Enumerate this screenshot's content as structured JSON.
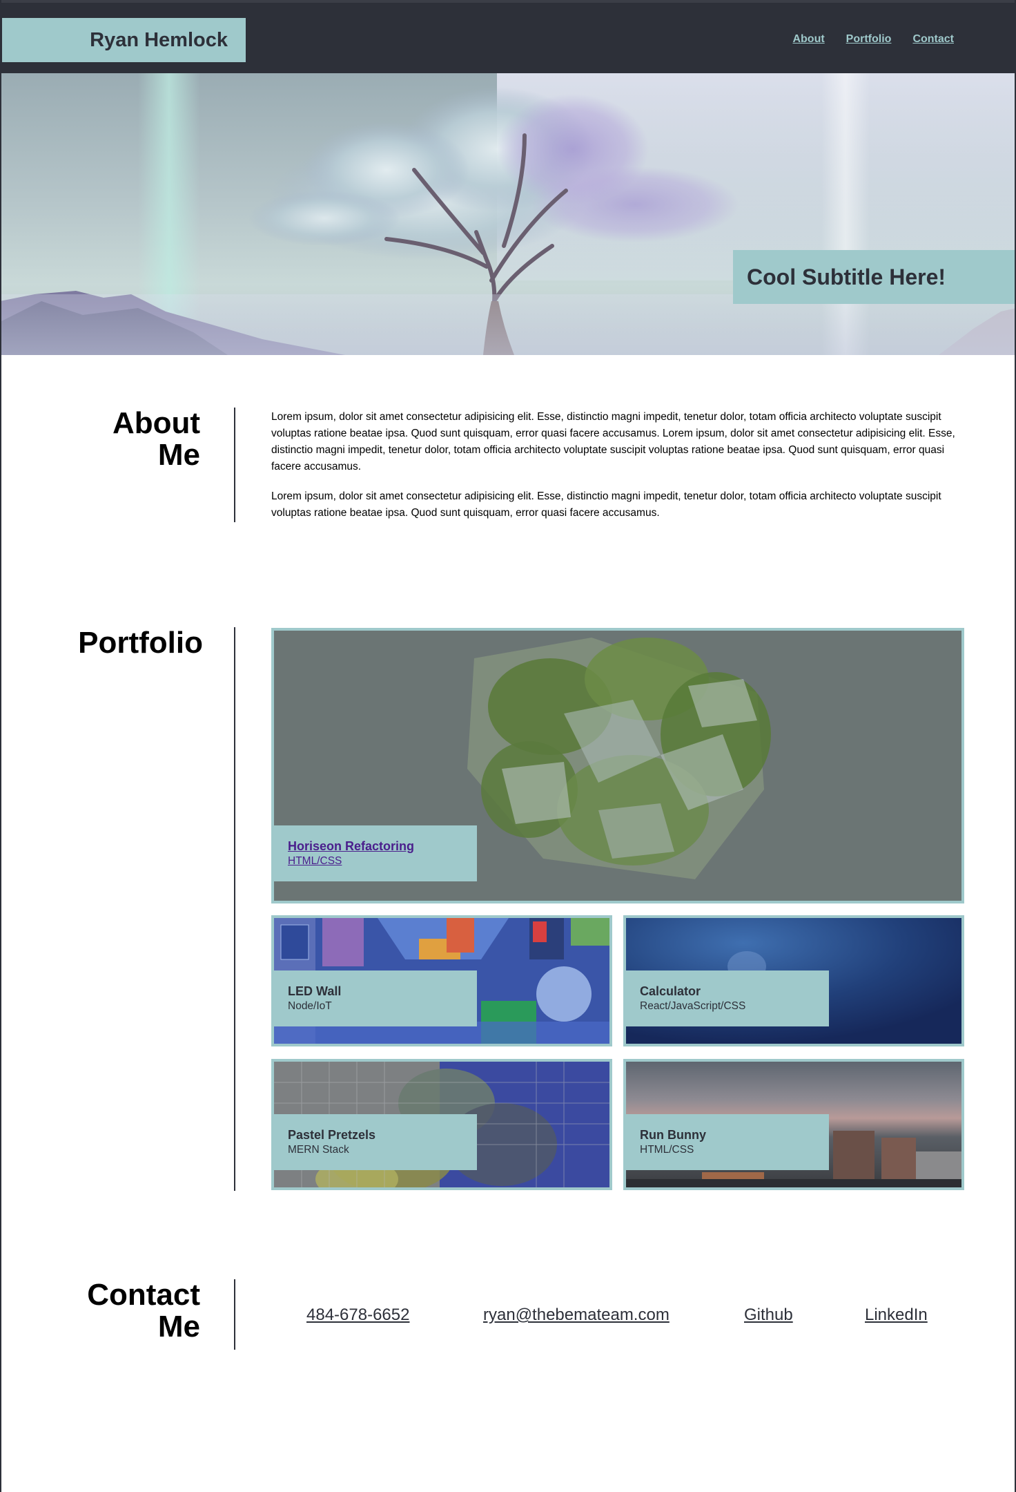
{
  "header": {
    "brand": "Ryan Hemlock",
    "nav": [
      "About",
      "Portfolio",
      "Contact"
    ]
  },
  "hero": {
    "subtitle": "Cool Subtitle Here!"
  },
  "about": {
    "title_line1": "About",
    "title_line2": "Me",
    "paragraphs": [
      "Lorem ipsum, dolor sit amet consectetur adipisicing elit. Esse, distinctio magni impedit, tenetur dolor, totam officia architecto voluptate suscipit voluptas ratione beatae ipsa. Quod sunt quisquam, error quasi facere accusamus. Lorem ipsum, dolor sit amet consectetur adipisicing elit. Esse, distinctio magni impedit, tenetur dolor, totam officia architecto voluptate suscipit voluptas ratione beatae ipsa. Quod sunt quisquam, error quasi facere accusamus.",
      "Lorem ipsum, dolor sit amet consectetur adipisicing elit. Esse, distinctio magni impedit, tenetur dolor, totam officia architecto voluptate suscipit voluptas ratione beatae ipsa. Quod sunt quisquam, error quasi facere accusamus."
    ]
  },
  "portfolio": {
    "title": "Portfolio",
    "projects": [
      {
        "name": "Horiseon Refactoring",
        "tech": "HTML/CSS"
      },
      {
        "name": "LED Wall",
        "tech": "Node/IoT"
      },
      {
        "name": "Calculator",
        "tech": "React/JavaScript/CSS"
      },
      {
        "name": "Pastel Pretzels",
        "tech": "MERN Stack"
      },
      {
        "name": "Run Bunny",
        "tech": "HTML/CSS"
      }
    ]
  },
  "contact": {
    "title_line1": "Contact",
    "title_line2": "Me",
    "phone": "484-678-6652",
    "email": "ryan@thebemateam.com",
    "github": "Github",
    "linkedin": "LinkedIn"
  },
  "colors": {
    "dark": "#2d3039",
    "accent": "#9fc9cb",
    "link_visited": "#4a1e8c"
  }
}
